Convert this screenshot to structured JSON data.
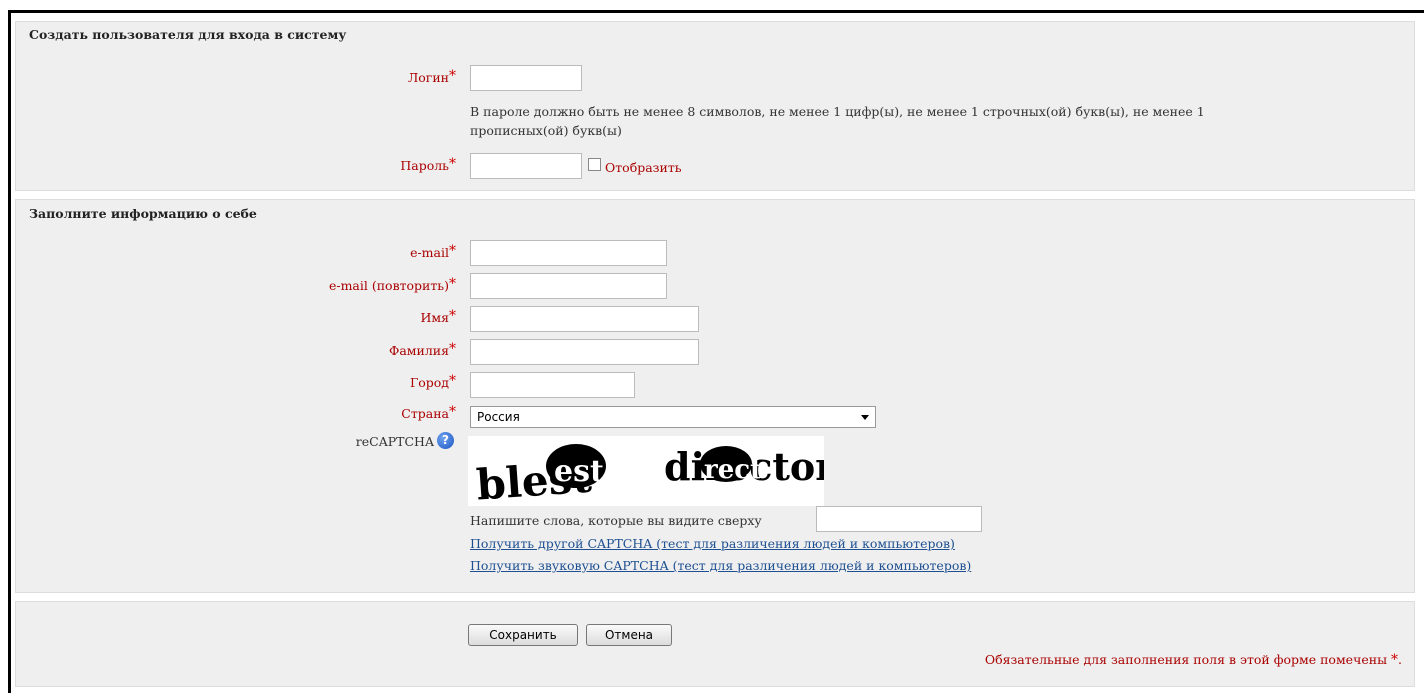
{
  "section_login": {
    "legend": "Создать пользователя для входа в систему",
    "login_label": "Логин",
    "login_value": "",
    "password_hint": "В пароле должно быть не менее 8 символов, не менее 1 цифр(ы), не менее 1 строчных(ой) букв(ы), не менее 1 прописных(ой) букв(ы)",
    "password_label": "Пароль",
    "password_value": "",
    "show_label": "Отобразить"
  },
  "section_info": {
    "legend": "Заполните информацию о себе",
    "email_label": "e-mail",
    "email_repeat_label": "e-mail (повторить)",
    "firstname_label": "Имя",
    "lastname_label": "Фамилия",
    "city_label": "Город",
    "country_label": "Страна",
    "country_value": "Россия",
    "recaptcha_label": "reCAPTCHA",
    "captcha_words": [
      "blest",
      "director"
    ],
    "captcha_prompt": "Напишите слова, которые вы видите сверху",
    "captcha_other_link": "Получить другой CAPTCHA (тест для различения людей и компьютеров)",
    "captcha_audio_link": "Получить звуковую CAPTCHA (тест для различения людей и компьютеров)"
  },
  "buttons": {
    "save": "Сохранить",
    "cancel": "Отмена"
  },
  "required_note": "Обязательные для заполнения поля в этой форме помечены",
  "required_marker": "*",
  "required_note_end": ".",
  "colors": {
    "label_red": "#aa0000",
    "link_blue": "#1d4f91",
    "panel_bg": "#efefef"
  }
}
